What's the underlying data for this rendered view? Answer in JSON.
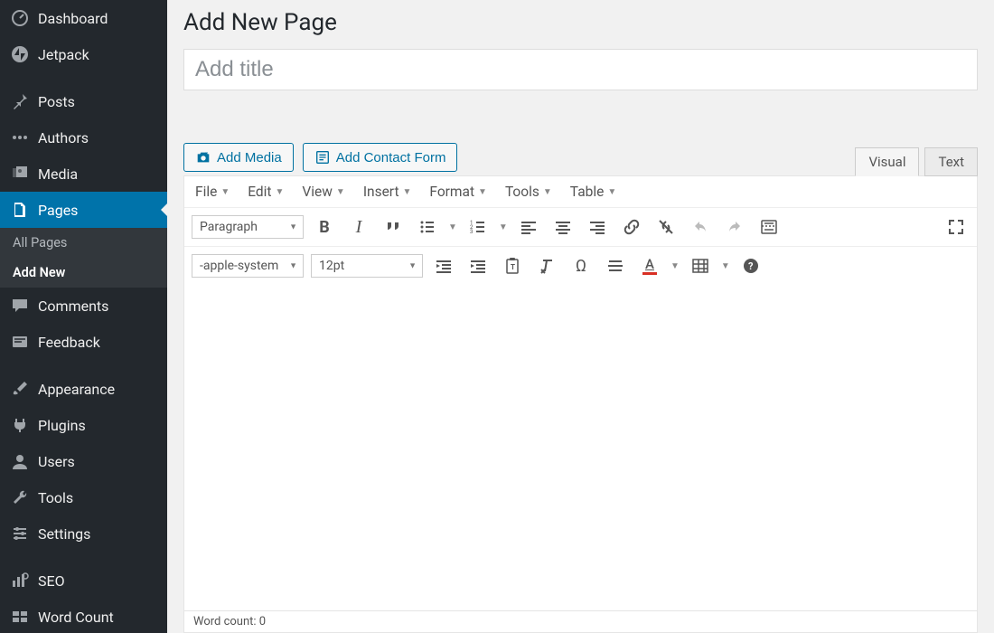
{
  "sidebar": {
    "items": [
      {
        "label": "Dashboard"
      },
      {
        "label": "Jetpack"
      },
      {
        "label": "Posts"
      },
      {
        "label": "Authors"
      },
      {
        "label": "Media"
      },
      {
        "label": "Pages"
      },
      {
        "label": "Comments"
      },
      {
        "label": "Feedback"
      },
      {
        "label": "Appearance"
      },
      {
        "label": "Plugins"
      },
      {
        "label": "Users"
      },
      {
        "label": "Tools"
      },
      {
        "label": "Settings"
      },
      {
        "label": "SEO"
      },
      {
        "label": "Word Count"
      }
    ],
    "sub": {
      "all_pages": "All Pages",
      "add_new": "Add New"
    }
  },
  "page": {
    "heading": "Add New Page",
    "title_placeholder": "Add title"
  },
  "buttons": {
    "add_media": "Add Media",
    "add_contact_form": "Add Contact Form"
  },
  "tabs": {
    "visual": "Visual",
    "text": "Text"
  },
  "menubar": {
    "file": "File",
    "edit": "Edit",
    "view": "View",
    "insert": "Insert",
    "format": "Format",
    "tools": "Tools",
    "table": "Table"
  },
  "toolbar1": {
    "format_select": "Paragraph"
  },
  "toolbar2": {
    "font_select": "-apple-system",
    "size_select": "12pt"
  },
  "status": {
    "word_count_label": "Word count: ",
    "word_count_value": "0"
  }
}
